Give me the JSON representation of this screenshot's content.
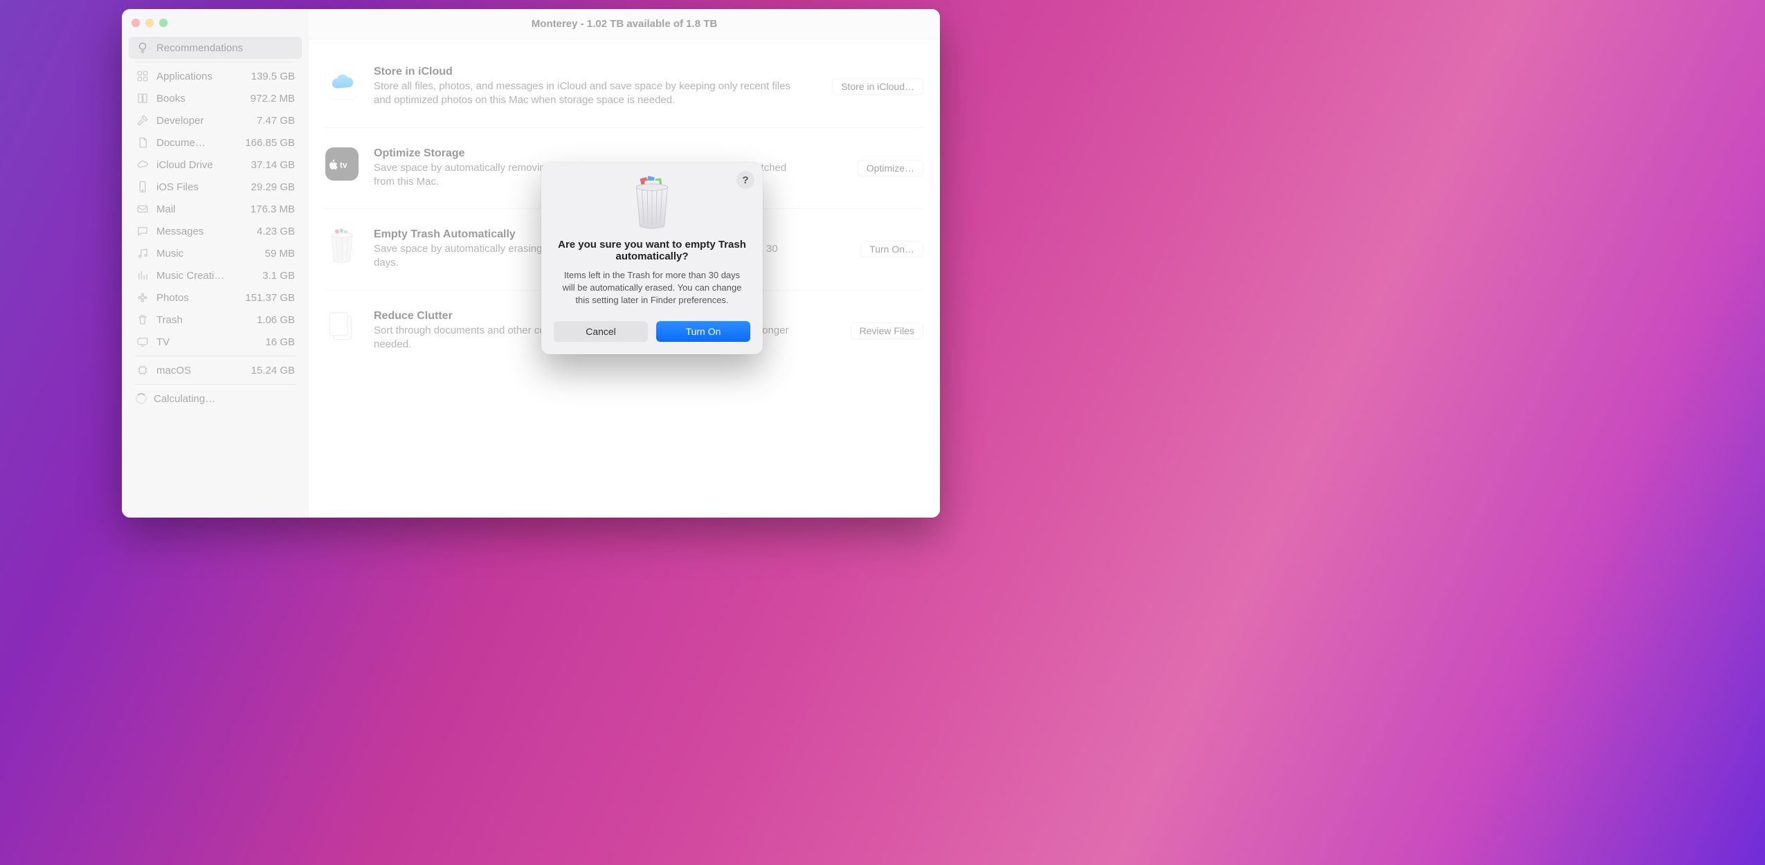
{
  "window_title": "Monterey - 1.02 TB available of 1.8 TB",
  "sidebar": {
    "selected_index": 0,
    "items": [
      {
        "icon": "bulb",
        "label": "Recommendations",
        "size": ""
      },
      {
        "icon": "apps",
        "label": "Applications",
        "size": "139.5 GB"
      },
      {
        "icon": "book",
        "label": "Books",
        "size": "972.2 MB"
      },
      {
        "icon": "hammer",
        "label": "Developer",
        "size": "7.47 GB"
      },
      {
        "icon": "doc",
        "label": "Docume…",
        "size": "166.85 GB"
      },
      {
        "icon": "cloud",
        "label": "iCloud Drive",
        "size": "37.14 GB"
      },
      {
        "icon": "phone",
        "label": "iOS Files",
        "size": "29.29 GB"
      },
      {
        "icon": "mail",
        "label": "Mail",
        "size": "176.3 MB"
      },
      {
        "icon": "msg",
        "label": "Messages",
        "size": "4.23 GB"
      },
      {
        "icon": "music",
        "label": "Music",
        "size": "59 MB"
      },
      {
        "icon": "mix",
        "label": "Music Creati…",
        "size": "3.1 GB"
      },
      {
        "icon": "photos",
        "label": "Photos",
        "size": "151.37 GB"
      },
      {
        "icon": "trash",
        "label": "Trash",
        "size": "1.06 GB"
      },
      {
        "icon": "tv",
        "label": "TV",
        "size": "16 GB"
      }
    ],
    "footer": [
      {
        "icon": "chip",
        "label": "macOS",
        "size": "15.24 GB"
      },
      {
        "icon": "spinner",
        "label": "Calculating…",
        "size": ""
      }
    ]
  },
  "blocks": [
    {
      "id": "icloud",
      "title": "Store in iCloud",
      "desc": "Store all files, photos, and messages in iCloud and save space by keeping only recent files and optimized photos on this Mac when storage space is needed.",
      "button": "Store in iCloud…",
      "icon": "cloud"
    },
    {
      "id": "optimize",
      "title": "Optimize Storage",
      "desc": "Save space by automatically removing movies and TV shows that you've already watched from this Mac.",
      "button": "Optimize…",
      "icon": "atv"
    },
    {
      "id": "trash",
      "title": "Empty Trash Automatically",
      "desc": "Save space by automatically erasing items that have been in the Trash for more than 30 days.",
      "button": "Turn On…",
      "icon": "trashc"
    },
    {
      "id": "clutter",
      "title": "Reduce Clutter",
      "desc": "Sort through documents and other content stored on this Mac and delete what is no longer needed.",
      "button": "Review Files",
      "icon": "docs"
    }
  ],
  "modal": {
    "title": "Are you sure you want to empty Trash automatically?",
    "body": "Items left in the Trash for more than 30 days will be automatically erased. You can change this setting later in Finder preferences.",
    "cancel": "Cancel",
    "confirm": "Turn On",
    "help": "?"
  }
}
